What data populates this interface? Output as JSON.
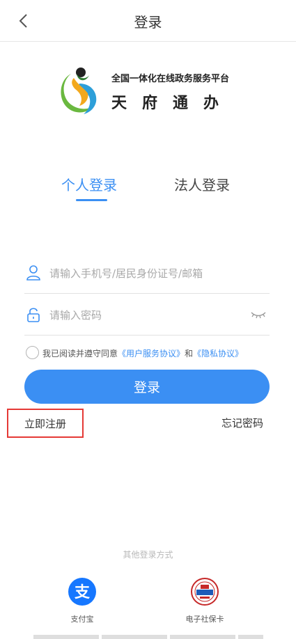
{
  "header": {
    "title": "登录"
  },
  "logo": {
    "subtitle": "全国一体化在线政务服务平台",
    "name": "天府通办"
  },
  "tabs": [
    {
      "label": "个人登录",
      "active": true
    },
    {
      "label": "法人登录",
      "active": false
    }
  ],
  "form": {
    "account_placeholder": "请输入手机号/居民身份证号/邮箱",
    "password_placeholder": "请输入密码"
  },
  "agreement": {
    "prefix": "我已阅读并遵守同意",
    "user_agreement": "《用户服务协议》",
    "and": "和",
    "privacy": "《隐私协议》"
  },
  "login_button": "登录",
  "register_link": "立即注册",
  "forgot_link": "忘记密码",
  "other_login": {
    "title": "其他登录方式",
    "methods": [
      {
        "label": "支付宝",
        "icon": "alipay-icon"
      },
      {
        "label": "电子社保卡",
        "icon": "social-security-card-icon"
      }
    ]
  },
  "colors": {
    "accent": "#3b8ff3",
    "highlight": "#e53935"
  }
}
